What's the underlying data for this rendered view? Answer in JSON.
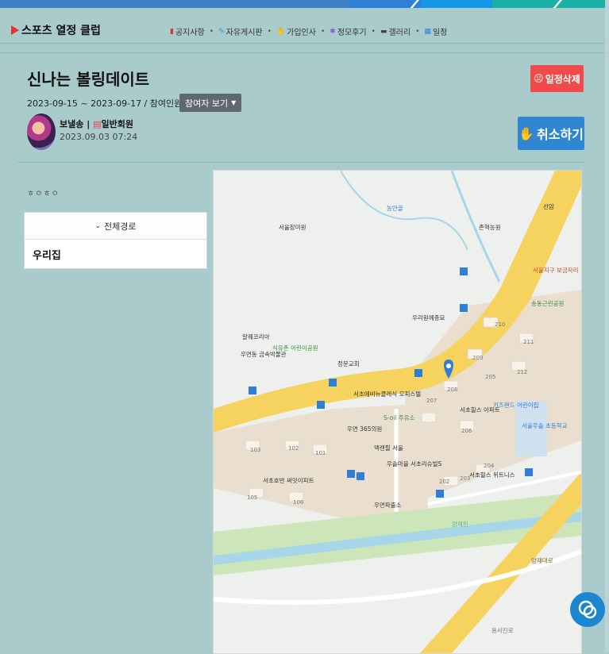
{
  "brand": {
    "name": "스포츠 열정 클럽"
  },
  "nav": {
    "items": [
      {
        "label": "공지사항",
        "icon": "notice-icon"
      },
      {
        "label": "자유게시판",
        "icon": "board-icon"
      },
      {
        "label": "가입인사",
        "icon": "greeting-icon"
      },
      {
        "label": "정모후기",
        "icon": "review-icon"
      },
      {
        "label": "갤러리",
        "icon": "gallery-icon"
      },
      {
        "label": "일정",
        "icon": "calendar-icon"
      }
    ],
    "separator": "•"
  },
  "event": {
    "title": "신나는 볼링데이트",
    "meta": "2023-09-15 ~ 2023-09-17 / 참여인원(3/10)",
    "participants_button": "참여자 보기",
    "author_name": "보낼송",
    "author_sep": "|",
    "author_role": "일반회원",
    "posted_at": "2023.09.03 07:24",
    "delete_button": "일정삭제",
    "cancel_button": "취소하기"
  },
  "left_panel": {
    "caption": "ㅎㅇㅎㅇ",
    "route_header": "전체경로",
    "route_items": [
      "우리집"
    ]
  },
  "map": {
    "labels": [
      "서울장미원",
      "농안골",
      "존혁농원",
      "선암",
      "서울지구 보금자리",
      "송동근린공원",
      "우리원예종묘",
      "알퀘코리아",
      "식유촌 어린이공원",
      "정문교회",
      "우면동 금속박물관",
      "서초에비뉴클레식 오피스텔",
      "S-oil 주유소",
      "우면 365의원",
      "서초힐스 아파트",
      "키즈랜드 어린이집",
      "서울우솔 초등학교",
      "맥렌필 서울",
      "우솔마을 서초리슈빌S",
      "서초호반 써밋이피트",
      "서초힐스 위트니스",
      "우면파출소",
      "양재천",
      "양재대로",
      "용사진로"
    ],
    "building_numbers": [
      "210",
      "211",
      "209",
      "212",
      "208",
      "207",
      "206",
      "205",
      "204",
      "203",
      "202",
      "103",
      "102",
      "101",
      "105",
      "106"
    ]
  },
  "colors": {
    "page_bg": "#a9cbcc",
    "delete": "#ef4b4b",
    "cancel": "#2f86d3",
    "chat": "#1d86d1",
    "road": "#f6d25e"
  }
}
